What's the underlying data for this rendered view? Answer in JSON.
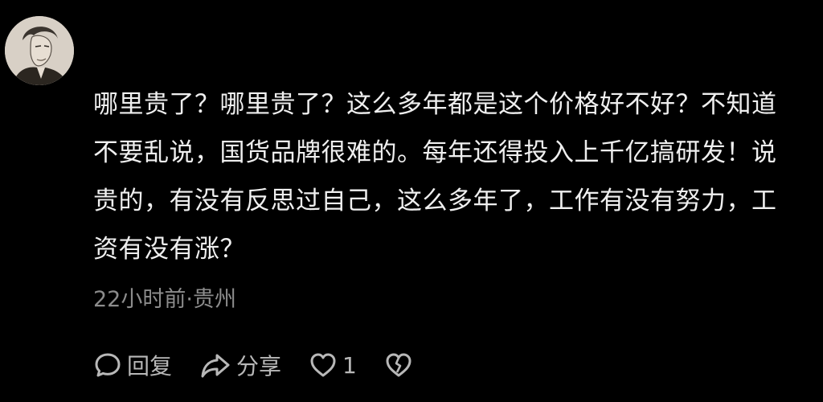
{
  "comment": {
    "text": "哪里贵了？哪里贵了？这么多年都是这个价格好不好？不知道不要乱说，国货品牌很难的。每年还得投入上千亿搞研发！说贵的，有没有反思过自己，这么多年了，工作有没有努力，工资有没有涨？",
    "time": "22小时前",
    "separator": "·",
    "location": "贵州"
  },
  "actions": {
    "reply_label": "回复",
    "share_label": "分享",
    "like_count": "1"
  },
  "icons": [
    "avatar",
    "comment-bubble-icon",
    "share-arrow-icon",
    "heart-icon",
    "broken-heart-icon"
  ]
}
